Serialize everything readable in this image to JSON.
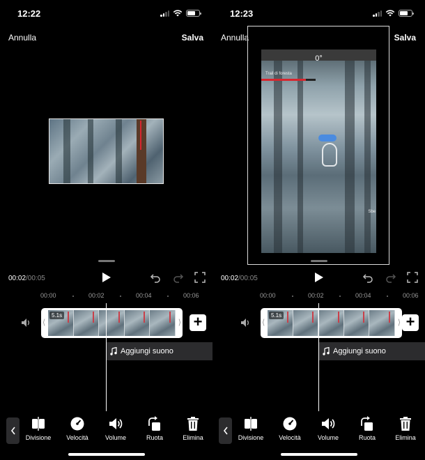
{
  "screens": [
    {
      "status": {
        "time": "12:22"
      },
      "header": {
        "cancel": "Annulla",
        "save": "Salva"
      },
      "player": {
        "current": "00:02",
        "total": "/00:05"
      },
      "ruler": [
        "00:00",
        "00:02",
        "00:04",
        "00:06"
      ],
      "clip": {
        "duration": "5.1s"
      },
      "sound": {
        "label": "Aggiungi suono"
      },
      "tools": [
        {
          "label": "Divisione",
          "icon": "split-icon"
        },
        {
          "label": "Velocità",
          "icon": "speed-icon"
        },
        {
          "label": "Volume",
          "icon": "volume-icon"
        },
        {
          "label": "Ruota",
          "icon": "rotate-icon"
        },
        {
          "label": "Elimina",
          "icon": "trash-icon"
        }
      ]
    },
    {
      "status": {
        "time": "12:23"
      },
      "header": {
        "cancel": "Annulla",
        "save": "Salva"
      },
      "rotation": "0°",
      "video_text": {
        "top": "Trail di foresta",
        "side": "Sbe"
      },
      "player": {
        "current": "00:02",
        "total": "/00:05"
      },
      "ruler": [
        "00:00",
        "00:02",
        "00:04",
        "00:06"
      ],
      "clip": {
        "duration": "5.1s"
      },
      "sound": {
        "label": "Aggiungi suono"
      },
      "tools": [
        {
          "label": "Divisione",
          "icon": "split-icon"
        },
        {
          "label": "Velocità",
          "icon": "speed-icon"
        },
        {
          "label": "Volume",
          "icon": "volume-icon"
        },
        {
          "label": "Ruota",
          "icon": "rotate-icon"
        },
        {
          "label": "Elimina",
          "icon": "trash-icon"
        }
      ]
    }
  ],
  "colors": {
    "background": "#000000",
    "panel": "#2c2c2e",
    "accent_red": "#d8262e",
    "text": "#ffffff",
    "muted": "#999999"
  }
}
